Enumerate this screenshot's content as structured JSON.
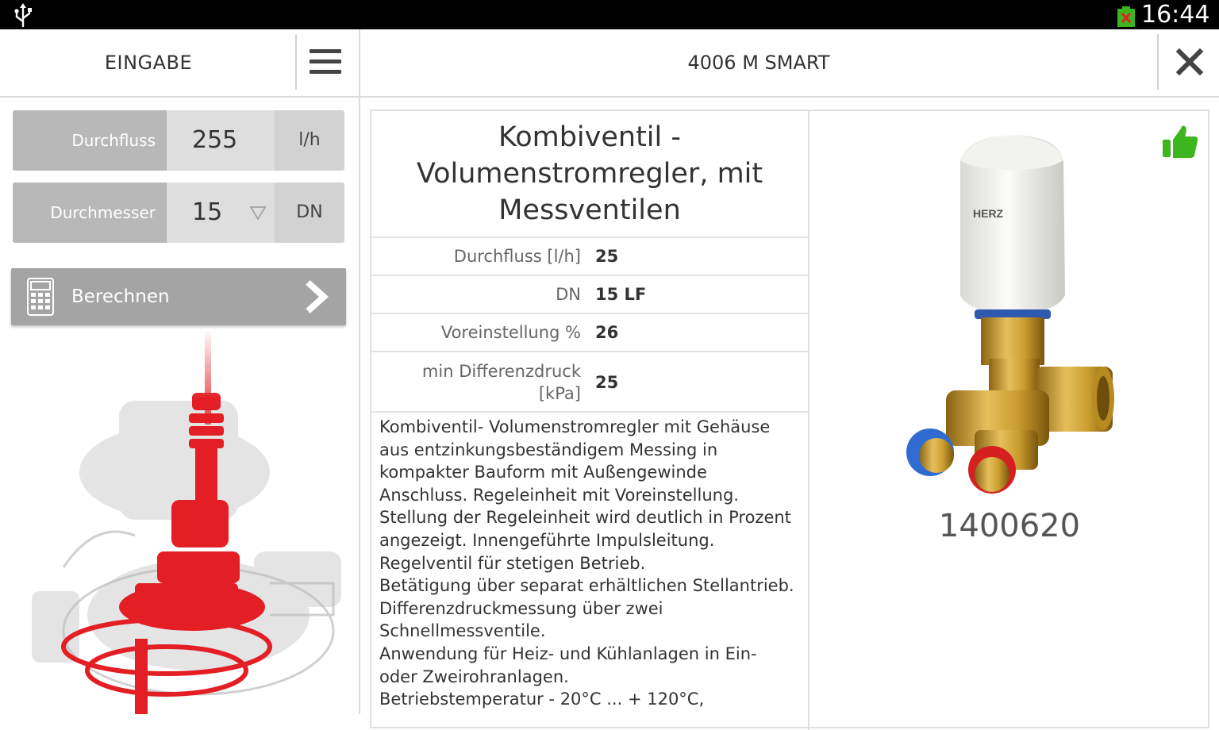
{
  "status_bar": {
    "time": "16:44",
    "usb_icon": "usb-icon",
    "battery_icon": "battery-icon"
  },
  "left_panel": {
    "title": "EINGABE",
    "menu_icon": "menu-icon",
    "fields": [
      {
        "label": "Durchfluss",
        "value": "255",
        "unit": "l/h"
      },
      {
        "label": "Durchmesser",
        "value": "15",
        "unit": "DN",
        "dropdown_icon": "dropdown-triangle-icon"
      }
    ],
    "calculate_button": {
      "label": "Berechnen",
      "icon": "calculator-icon",
      "arrow_icon": "chevron-right-icon"
    }
  },
  "right_panel": {
    "title": "4006 M SMART",
    "close_icon": "close-icon",
    "product": {
      "name": "Kombiventil -\nVolumenstromregler, mit\nMessventilen",
      "specs": [
        {
          "label": "Durchfluss [l/h]",
          "value": "25"
        },
        {
          "label": "DN",
          "value": "15 LF"
        },
        {
          "label": "Voreinstellung %",
          "value": "26"
        },
        {
          "label": "min Differenzdruck\n[kPa]",
          "value": "25"
        }
      ],
      "description": "Kombiventil- Volumenstromregler mit Gehäuse\naus entzinkungsbeständigem Messing in\nkompakter Bauform mit Außengewinde\nAnschluss. Regeleinheit mit Voreinstellung.\nStellung der Regeleinheit wird deutlich in Prozent\nangezeigt. Innengeführte Impulsleitung.\nRegelventil für stetigen Betrieb.\nBetätigung über separat erhältlichen Stellantrieb.\nDifferenzdruckmessung über zwei\nSchnellmessventile.\nAnwendung für Heiz- und Kühlanlagen in Ein-\noder Zweirohranlagen.\nBetriebstemperatur - 20°C ... + 120°C,",
      "image_brand": "HERZ",
      "article_number": "1400620",
      "recommend_icon": "thumbs-up-icon"
    }
  },
  "colors": {
    "accent_green": "#3db51f",
    "illustration_red": "#e31e24",
    "label_gray": "#b8b8b8"
  }
}
